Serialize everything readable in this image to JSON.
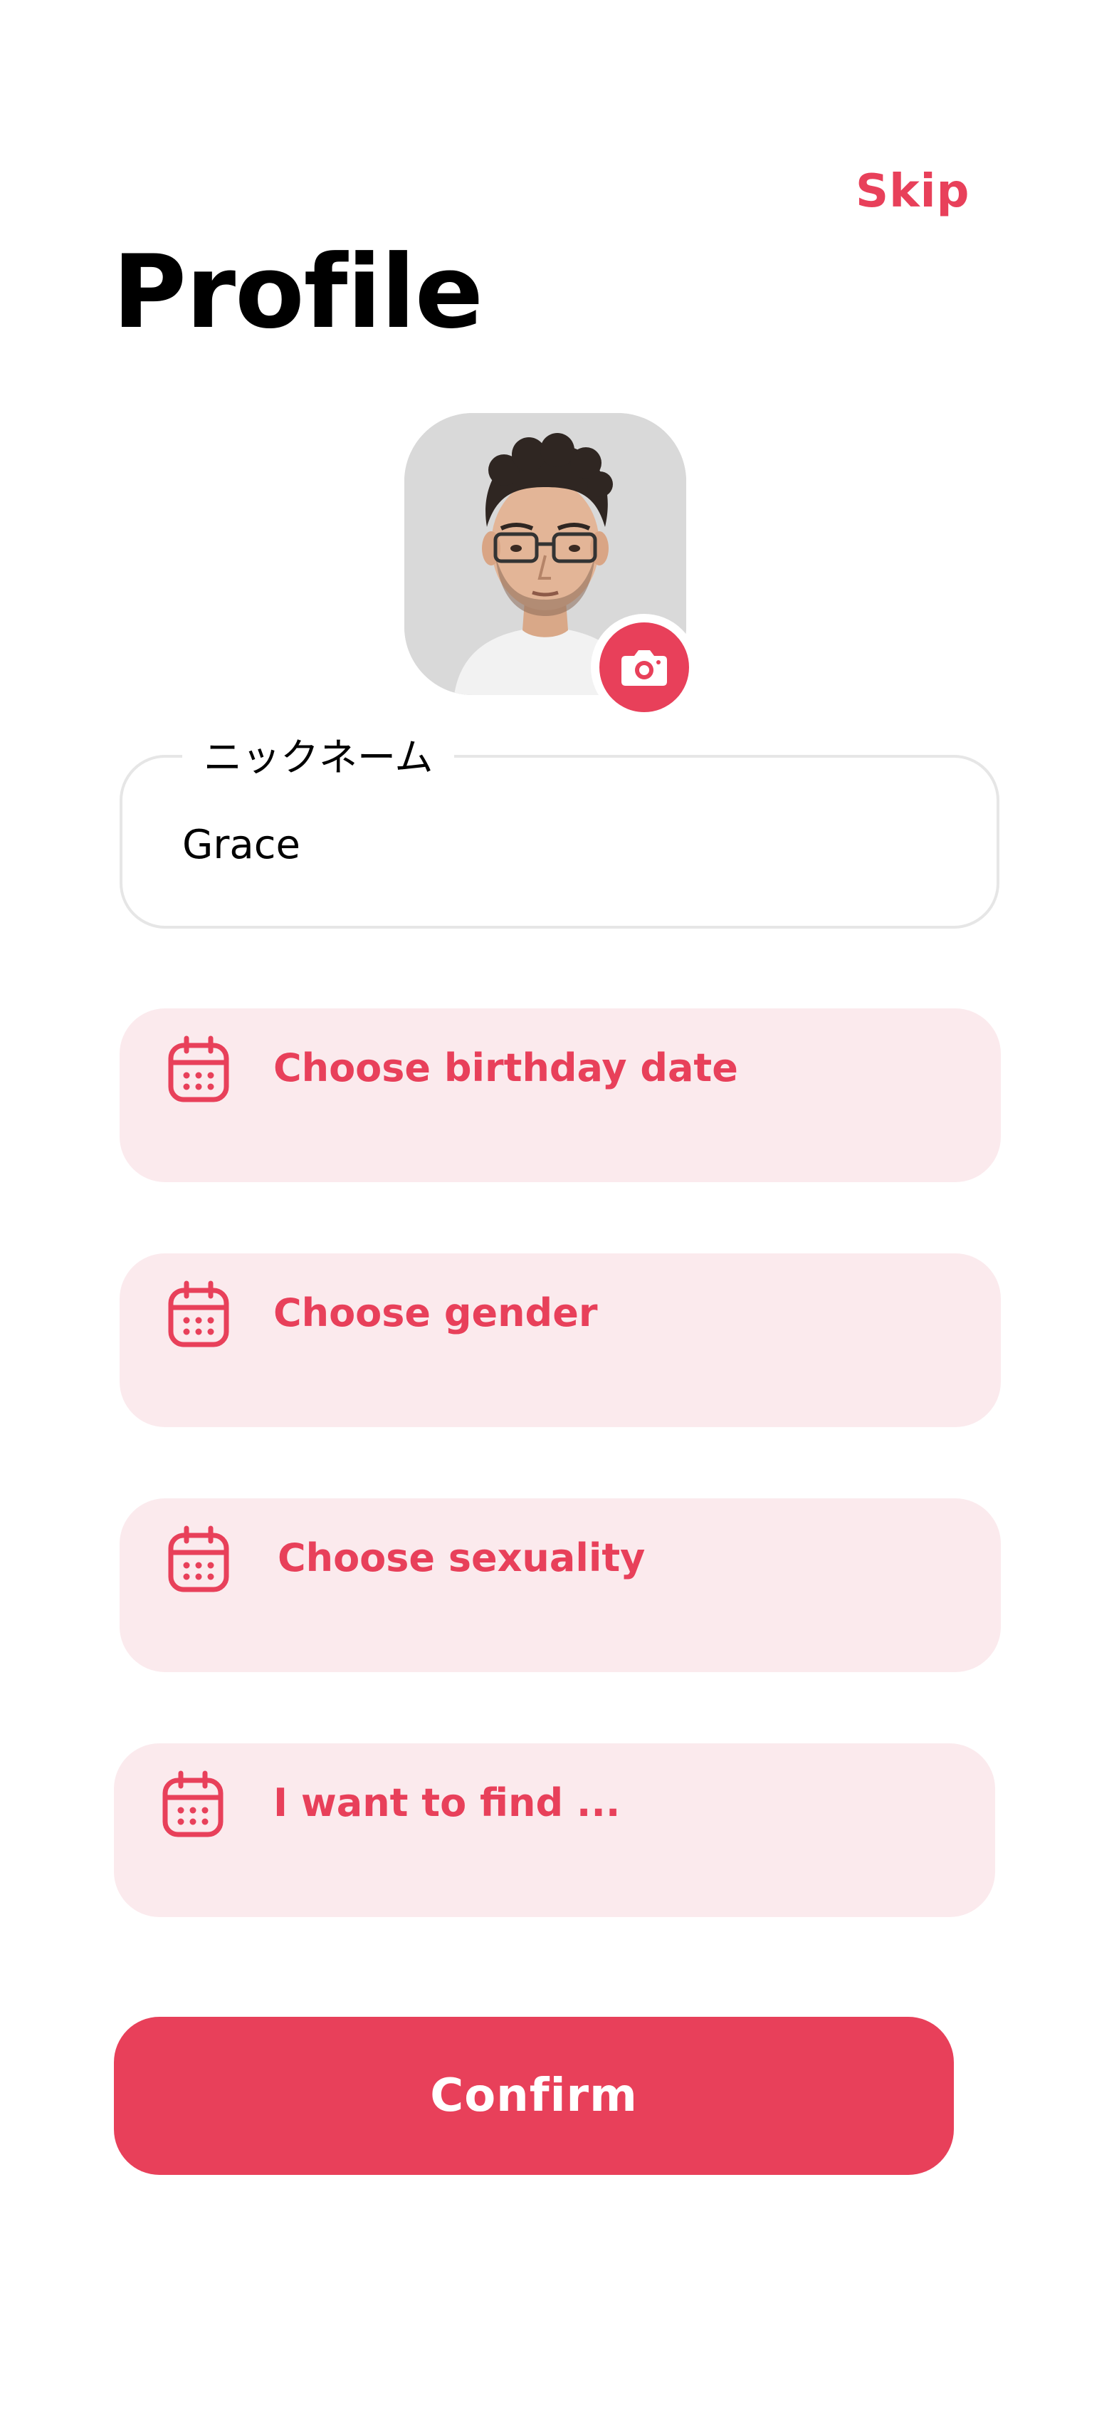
{
  "header": {
    "skip_label": "Skip",
    "title": "Profile"
  },
  "avatar": {
    "icon": "person-photo",
    "camera_icon": "camera-icon"
  },
  "nickname": {
    "label": "ニックネーム",
    "value": "Grace"
  },
  "options": [
    {
      "icon": "calendar-icon",
      "label": "Choose birthday date"
    },
    {
      "icon": "calendar-icon",
      "label": "Choose gender"
    },
    {
      "icon": "calendar-icon",
      "label": "Choose sexuality"
    },
    {
      "icon": "calendar-icon",
      "label": "I want to find ..."
    }
  ],
  "confirm_label": "Confirm",
  "colors": {
    "accent": "#e8405a",
    "option_background": "#fbeaed",
    "field_border": "#e6e6e6"
  }
}
